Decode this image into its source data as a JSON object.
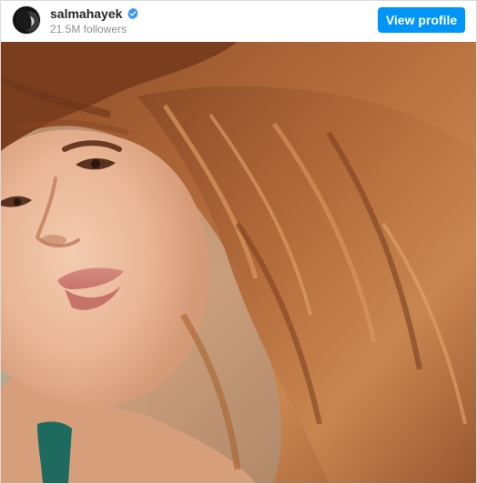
{
  "post": {
    "username": "salmahayek",
    "followers": "21.5M followers",
    "view_profile_label": "View profile"
  },
  "icons": {
    "verified": "verified-badge-icon",
    "avatar": "profile-avatar"
  },
  "colors": {
    "button_blue": "#0095f6",
    "verified_blue": "#3897f0",
    "username_text": "#262626",
    "secondary_text": "#8e8e8e"
  }
}
